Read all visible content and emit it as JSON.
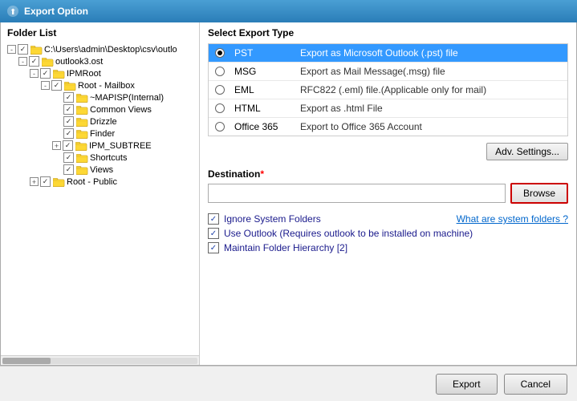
{
  "titleBar": {
    "title": "Export Option",
    "iconColor": "#fff"
  },
  "leftPanel": {
    "header": "Folder List",
    "tree": [
      {
        "id": "root-path",
        "indent": 1,
        "expand": "-",
        "checked": true,
        "hasFolder": true,
        "label": "C:\\Users\\admin\\Desktop\\csv\\outlo"
      },
      {
        "id": "ost-file",
        "indent": 2,
        "expand": "-",
        "checked": true,
        "hasFolder": true,
        "label": "outlook3.ost"
      },
      {
        "id": "ipmroot",
        "indent": 3,
        "expand": "-",
        "checked": true,
        "hasFolder": true,
        "label": "IPMRoot"
      },
      {
        "id": "root-mailbox",
        "indent": 4,
        "expand": "-",
        "checked": true,
        "hasFolder": true,
        "label": "Root - Mailbox"
      },
      {
        "id": "mapisp",
        "indent": 5,
        "expand": null,
        "checked": true,
        "hasFolder": true,
        "label": "~MAPISP(Internal)"
      },
      {
        "id": "common-views",
        "indent": 5,
        "expand": null,
        "checked": true,
        "hasFolder": true,
        "label": "Common Views"
      },
      {
        "id": "drizzle",
        "indent": 5,
        "expand": null,
        "checked": true,
        "hasFolder": true,
        "label": "Drizzle"
      },
      {
        "id": "finder",
        "indent": 5,
        "expand": null,
        "checked": true,
        "hasFolder": true,
        "label": "Finder"
      },
      {
        "id": "ipm-subtree",
        "indent": 5,
        "expand": "+",
        "checked": true,
        "hasFolder": true,
        "label": "IPM_SUBTREE"
      },
      {
        "id": "shortcuts",
        "indent": 5,
        "expand": null,
        "checked": true,
        "hasFolder": true,
        "label": "Shortcuts"
      },
      {
        "id": "views",
        "indent": 5,
        "expand": null,
        "checked": true,
        "hasFolder": true,
        "label": "Views"
      },
      {
        "id": "root-public",
        "indent": 3,
        "expand": "+",
        "checked": true,
        "hasFolder": true,
        "label": "Root - Public"
      }
    ]
  },
  "rightPanel": {
    "header": "Select Export Type",
    "exportTypes": [
      {
        "id": "pst",
        "type": "PST",
        "desc": "Export as Microsoft Outlook (.pst) file",
        "selected": true
      },
      {
        "id": "msg",
        "type": "MSG",
        "desc": "Export as Mail Message(.msg) file",
        "selected": false
      },
      {
        "id": "eml",
        "type": "EML",
        "desc": "RFC822 (.eml) file.(Applicable only for mail)",
        "selected": false
      },
      {
        "id": "html",
        "type": "HTML",
        "desc": "Export as .html File",
        "selected": false
      },
      {
        "id": "office365",
        "type": "Office 365",
        "desc": "Export to Office 365 Account",
        "selected": false
      }
    ],
    "advSettingsBtn": "Adv. Settings...",
    "destination": {
      "label": "Destination",
      "required": "*",
      "placeholder": "",
      "browseBtn": "Browse"
    },
    "options": [
      {
        "id": "ignore-system",
        "label": "Ignore System Folders",
        "checked": true,
        "link": "What are system folders ?"
      },
      {
        "id": "use-outlook",
        "label": "Use Outlook (Requires outlook to be installed on machine)",
        "checked": true,
        "link": null
      },
      {
        "id": "maintain-hierarchy",
        "label": "Maintain Folder Hierarchy [2]",
        "checked": true,
        "link": null
      }
    ]
  },
  "bottomBar": {
    "exportBtn": "Export",
    "cancelBtn": "Cancel"
  }
}
